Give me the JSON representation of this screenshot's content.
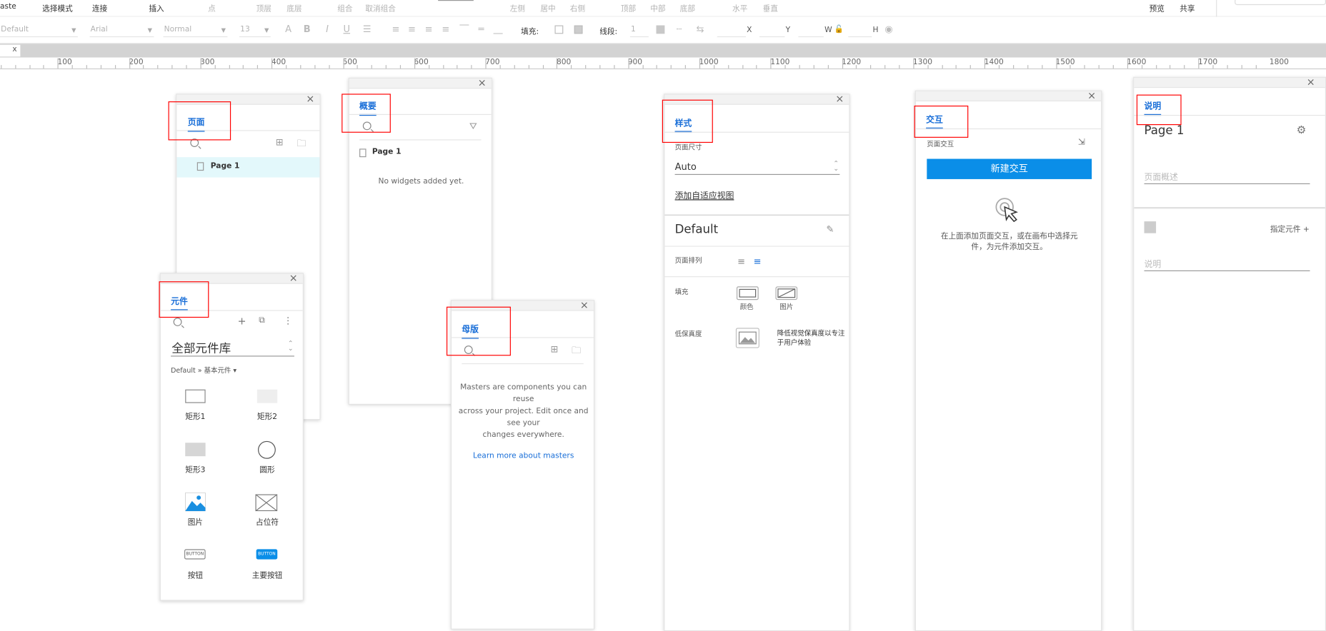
{
  "toolbar": {
    "paste": "aste",
    "select_mode": "选择模式",
    "connect": "连接",
    "insert": "插入",
    "point": "点",
    "top_layer": "顶层",
    "bottom_layer": "底层",
    "group": "组合",
    "ungroup": "取消组合",
    "align_left": "左侧",
    "align_center": "居中",
    "align_right": "右侧",
    "align_top": "顶部",
    "align_middle": "中部",
    "align_bottom": "底部",
    "horizontal": "水平",
    "vertical": "垂直",
    "preview": "预览",
    "share": "共享"
  },
  "format": {
    "style": "Default",
    "font": "Arial",
    "weight": "Normal",
    "size": "13",
    "fill_label": "填充:",
    "line_label": "线段:",
    "line_value": "1",
    "x_label": "X",
    "y_label": "Y",
    "w_label": "W",
    "h_label": "H"
  },
  "canvas_tab": "x",
  "ruler": [
    "100",
    "200",
    "300",
    "400",
    "500",
    "600",
    "700",
    "800",
    "900",
    "1000",
    "1100",
    "1200",
    "1300",
    "1400",
    "1500",
    "1600",
    "1700",
    "1800"
  ],
  "pages": {
    "tab": "页面",
    "items": [
      "Page 1"
    ]
  },
  "outline": {
    "tab": "概要",
    "items": [
      "Page 1"
    ],
    "empty": "No widgets added yet."
  },
  "library": {
    "tab": "元件",
    "name": "全部元件库",
    "breadcrumb": "Default » 基本元件 ▾",
    "widgets": [
      "矩形1",
      "矩形2",
      "矩形3",
      "圆形",
      "图片",
      "占位符",
      "按钮",
      "主要按钮"
    ],
    "btn_text": "BUTTON"
  },
  "masters": {
    "tab": "母版",
    "desc1": "Masters are components you can reuse",
    "desc2": "across your project. Edit once and see your",
    "desc3": "changes everywhere.",
    "link": "Learn more about masters"
  },
  "style": {
    "tab": "样式",
    "size_label": "页面尺寸",
    "size_value": "Auto",
    "adaptive": "添加自适应视图",
    "style_name": "Default",
    "align_label": "页面排列",
    "fill_label": "填充",
    "fill_color": "颜色",
    "fill_image": "图片",
    "lowfi_label": "低保真度",
    "lowfi_desc1": "降低视觉保真度以专注",
    "lowfi_desc2": "于用户体验"
  },
  "interaction": {
    "tab": "交互",
    "page_label": "页面交互",
    "new_button": "新建交互",
    "hint1": "在上面添加页面交互，或在画布中选择元",
    "hint2": "件，为元件添加交互。"
  },
  "notes": {
    "tab": "说明",
    "page_name": "Page 1",
    "desc_placeholder": "页面概述",
    "assign": "指定元件 +",
    "note_placeholder": "说明"
  },
  "colors": {
    "accent": "#0a8ee8",
    "tab_blue": "#1a6fd8",
    "highlight": "#ff0000",
    "selected_row": "#e3f8fb"
  }
}
